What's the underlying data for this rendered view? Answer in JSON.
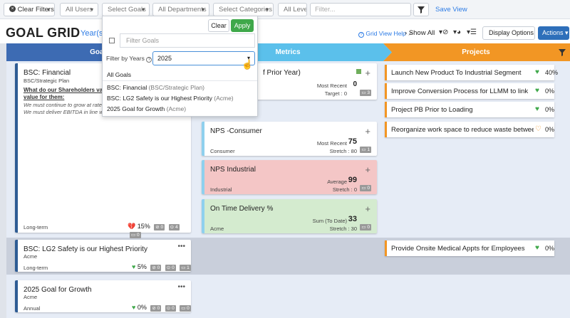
{
  "filters": {
    "clear_filters": "Clear Filters",
    "all_users": "All Users",
    "select_goals": "Select Goals",
    "all_departments": "All Departments",
    "select_categories": "Select Categories",
    "all_levels": "All Levels",
    "filter_placeholder": "Filter...",
    "save_view": "Save View"
  },
  "header": {
    "title": "GOAL GRID",
    "subtitle": "Year(s)",
    "grid_view_help": "Grid View Help",
    "show_all": "Show All",
    "display_options": "Display Options",
    "actions": "Actions"
  },
  "banners": {
    "goals": "Goals",
    "metrics": "Metrics",
    "projects": "Projects"
  },
  "colors": {
    "goals_banner": "#3d6bb3",
    "metrics_banner": "#5bc0eb",
    "projects_banner": "#f29624",
    "apply_green": "#3fa84a",
    "accent_blue": "#2c7be5"
  },
  "goals": [
    {
      "title": "BSC: Financial",
      "sub": "BSC/Strategic Plan",
      "question": "What do our Shareholders value",
      "question2": "value for them:",
      "line1": "We must continue to grow at rates",
      "line2": "We must deliver EBITDA in line w",
      "term": "Long-term",
      "pct": "15%",
      "c1": "0",
      "c2": "4",
      "c3": "0"
    },
    {
      "title": "BSC: LG2 Safety is our Highest Priority",
      "sub": "Acme",
      "term": "Long-term",
      "pct": "5%",
      "c1": "0",
      "c2": "0",
      "c3": "1"
    },
    {
      "title": "2025 Goal for Growth",
      "sub": "Acme",
      "term": "Annual",
      "pct": "0%",
      "c1": "0",
      "c2": "0",
      "c3": "0"
    }
  ],
  "metrics": [
    {
      "title": "f Prior Year)",
      "label": "Most Recent",
      "value": "0",
      "sub_label": "Target : 0",
      "badge": "3"
    },
    {
      "title": "NPS -Consumer",
      "label": "Most Recent",
      "value": "75",
      "sub_label": "Stretch : 80",
      "dept": "Consumer",
      "badge": "1"
    },
    {
      "title": "NPS Industrial",
      "label": "Average",
      "value": "99",
      "sub_label": "Stretch : 0",
      "dept": "Industrial",
      "badge": "0"
    },
    {
      "title": "On Time Delivery %",
      "label": "Sum (To Date)",
      "value": "33",
      "sub_label": "Stretch : 30",
      "dept": "Acme",
      "badge": "0"
    }
  ],
  "projects": [
    {
      "title": "Launch New Product To Industrial Segment",
      "pct": "40%",
      "heart": "green"
    },
    {
      "title": "Improve Conversion Process for LLMM to link",
      "pct": "0%",
      "heart": "green"
    },
    {
      "title": "Project PB Prior to Loading",
      "pct": "0%",
      "heart": "green"
    },
    {
      "title": "Reorganize work space to reduce waste between st...",
      "pct": "0%",
      "heart": "orange"
    },
    {
      "title": "Provide Onsite Medical Appts for Employees",
      "pct": "0%",
      "heart": "green"
    }
  ],
  "dropdown": {
    "clear": "Clear",
    "apply": "Apply",
    "filter_goals_placeholder": "Filter Goals",
    "filter_by_years": "Filter by Years",
    "year_value": "2025",
    "items": [
      {
        "label": "All Goals",
        "group": ""
      },
      {
        "label": "BSC: Financial",
        "group": "(BSC/Strategic Plan)"
      },
      {
        "label": "BSC: LG2 Safety is our Highest Priority",
        "group": "(Acme)"
      },
      {
        "label": "2025 Goal for Growth",
        "group": "(Acme)"
      }
    ]
  }
}
